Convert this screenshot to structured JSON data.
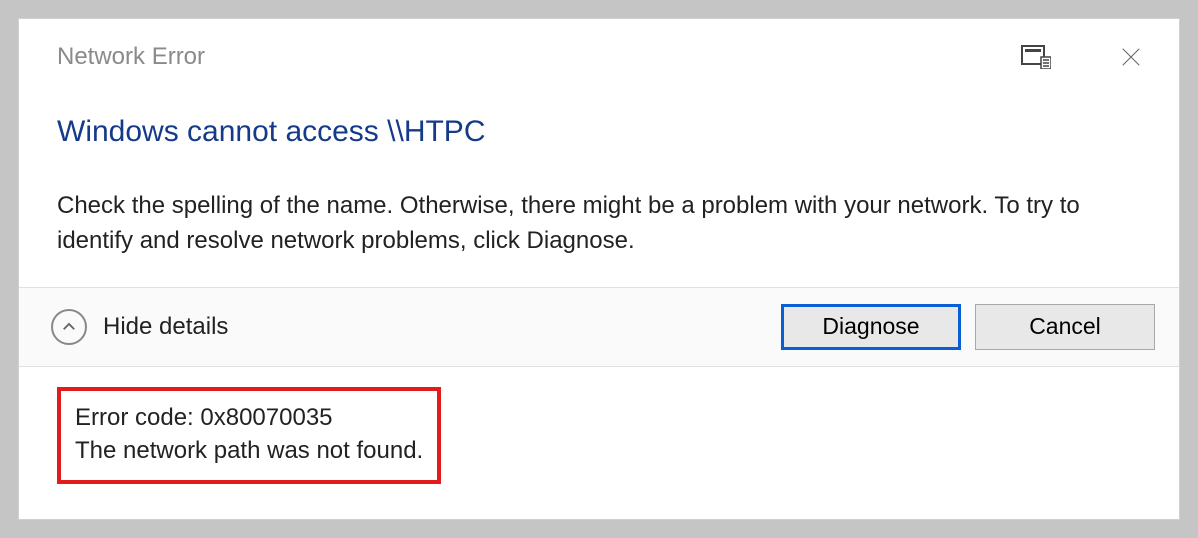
{
  "titlebar": {
    "title": "Network Error"
  },
  "main": {
    "heading": "Windows cannot access \\\\HTPC",
    "description": "Check the spelling of the name. Otherwise, there might be a problem with your network. To try to identify and resolve network problems, click Diagnose."
  },
  "actions": {
    "details_toggle": "Hide details",
    "diagnose": "Diagnose",
    "cancel": "Cancel"
  },
  "details": {
    "error_code_line": "Error code: 0x80070035",
    "error_message_line": "The network path was not found."
  }
}
